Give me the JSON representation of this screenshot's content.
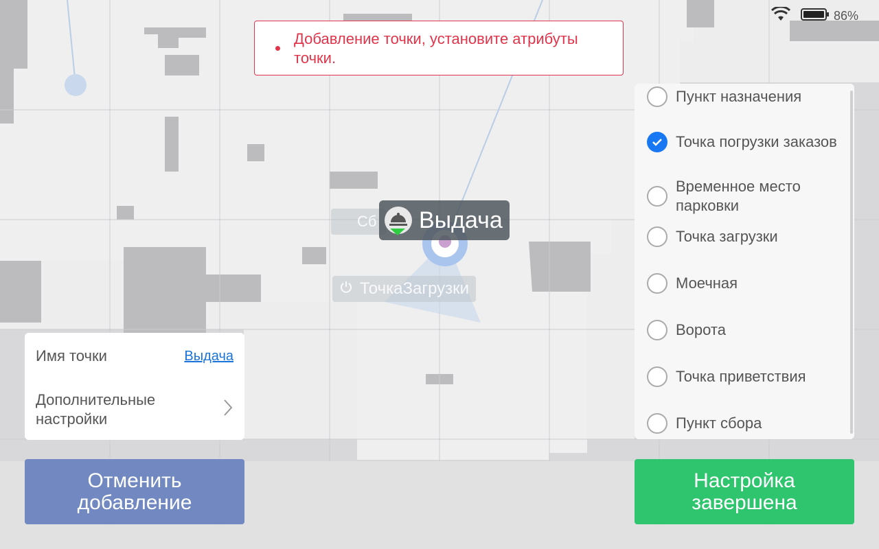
{
  "status_bar": {
    "battery_percent": "86%",
    "wifi_icon": "wifi-icon",
    "battery_icon": "battery-icon"
  },
  "toast": {
    "message": "Добавление точки, установите атрибуты точки.",
    "color": "#e0354b"
  },
  "map": {
    "marker_label": "Выдача",
    "marker_icon": "food-cover-icon",
    "ghost_label": "ТочкаЗагрузки",
    "ghost_label_partial": "Сб"
  },
  "info_card": {
    "name_label": "Имя точки",
    "name_value": "Выдача",
    "advanced_label": "Дополнительные настройки",
    "advanced_icon": "chevron-right-icon"
  },
  "point_types": {
    "items": [
      {
        "label": "Пункт назначения",
        "checked": false
      },
      {
        "label": "Точка погрузки заказов",
        "checked": true
      },
      {
        "label": "Временное место парковки",
        "checked": false
      },
      {
        "label": "Точка загрузки",
        "checked": false
      },
      {
        "label": "Моечная",
        "checked": false
      },
      {
        "label": "Ворота",
        "checked": false
      },
      {
        "label": "Точка приветствия",
        "checked": false
      },
      {
        "label": "Пункт сбора",
        "checked": false
      }
    ]
  },
  "buttons": {
    "cancel_label": "Отменить добавление",
    "done_label": "Настройка завершена",
    "cancel_color": "#7189c0",
    "done_color": "#2fc56e"
  }
}
